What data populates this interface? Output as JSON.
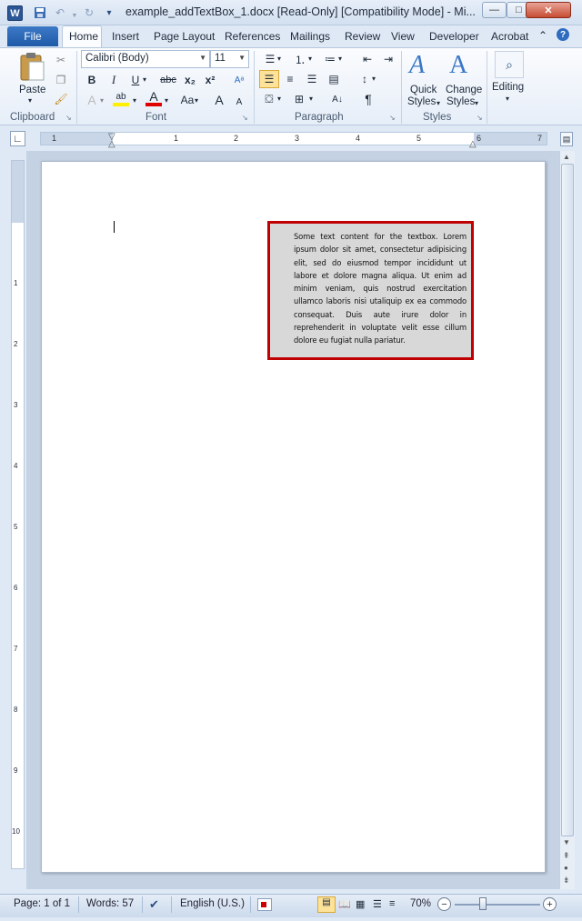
{
  "window": {
    "title": "example_addTextBox_1.docx [Read-Only] [Compatibility Mode]  -  Mi...",
    "app_icon_letter": "W",
    "minimize": "—",
    "maximize": "□",
    "close": "✕"
  },
  "ribbon_tabs": [
    "File",
    "Home",
    "Insert",
    "Page Layout",
    "References",
    "Mailings",
    "Review",
    "View",
    "Developer",
    "Acrobat"
  ],
  "ribbon": {
    "clipboard": {
      "paste_label": "Paste",
      "group_label": "Clipboard"
    },
    "font": {
      "font_name": "Calibri (Body)",
      "font_size": "11",
      "group_label": "Font",
      "bold": "B",
      "italic": "I",
      "underline": "U",
      "strike": "abc",
      "subscript": "x₂",
      "superscript": "x²",
      "highlight": "ab",
      "font_color": "A",
      "change_case": "Aa",
      "grow": "A",
      "shrink": "A"
    },
    "paragraph": {
      "group_label": "Paragraph",
      "show_marks": "¶"
    },
    "styles": {
      "quick_styles_line1": "Quick",
      "quick_styles_line2": "Styles",
      "change_styles_line1": "Change",
      "change_styles_line2": "Styles",
      "group_label": "Styles"
    },
    "editing": {
      "label": "Editing"
    }
  },
  "ruler_numbers": [
    "1",
    "1",
    "2",
    "3",
    "4",
    "5",
    "6",
    "7"
  ],
  "ruler_v_numbers": [
    "1",
    "2",
    "3",
    "4",
    "5",
    "6",
    "7",
    "8",
    "9",
    "10"
  ],
  "document": {
    "textbox_text": "Some text content  for the  textbox.  Lorem ipsum  dolor  sit amet, consectetur  adipisicing elit, sed do eiusmod  tempor incididunt  ut labore et dolore magna aliqua. Ut enim ad minim  veniam,  quis nostrud  exercitation ullamco laboris nisi  utaliquip  ex ea commodo  consequat.  Duis aute irure dolor in reprehenderit  in voluptate  velit esse cillum  dolore  eu fugiat  nulla pariatur."
  },
  "status": {
    "page": "Page: 1 of 1",
    "words": "Words: 57",
    "language": "English (U.S.)",
    "zoom": "70%",
    "zoom_minus": "−",
    "zoom_plus": "+"
  },
  "colors": {
    "textbox_border": "#c00000",
    "textbox_fill": "#d8d8d8",
    "file_tab": "#1f5aa8"
  }
}
